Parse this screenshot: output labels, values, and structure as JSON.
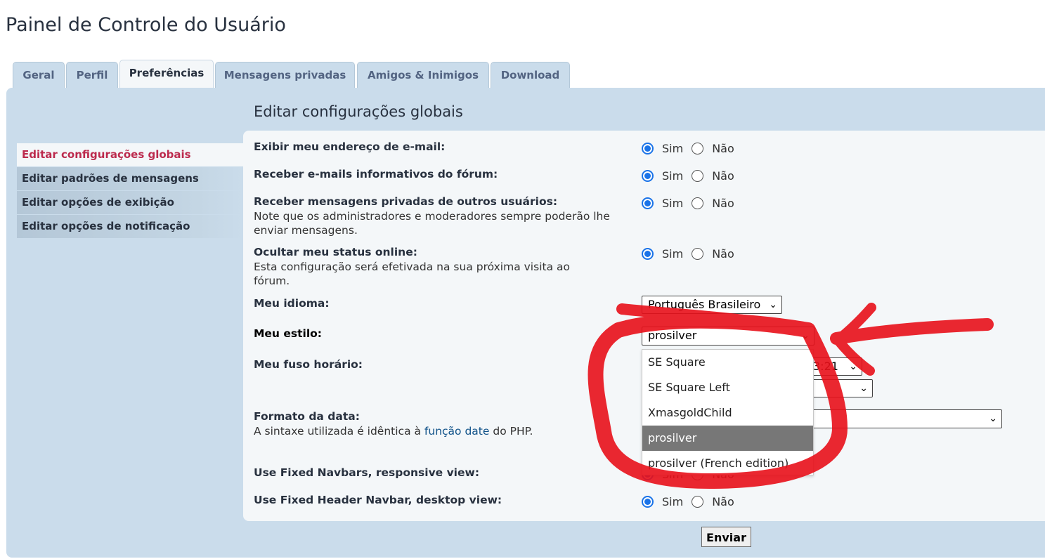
{
  "page_title": "Painel de Controle do Usuário",
  "tabs": [
    {
      "label": "Geral"
    },
    {
      "label": "Perfil"
    },
    {
      "label": "Preferências"
    },
    {
      "label": "Mensagens privadas"
    },
    {
      "label": "Amigos & Inimigos"
    },
    {
      "label": "Download"
    }
  ],
  "content_title": "Editar configurações globais",
  "sidebar": {
    "items": [
      {
        "label": "Editar configurações globais"
      },
      {
        "label": "Editar padrões de mensagens"
      },
      {
        "label": "Editar opções de exibição"
      },
      {
        "label": "Editar opções de notificação"
      }
    ]
  },
  "options": {
    "yes": "Sim",
    "no": "Não"
  },
  "fields": {
    "email": {
      "label": "Exibir meu endereço de e-mail:"
    },
    "massemail": {
      "label": "Receber e-mails informativos do fórum:"
    },
    "pm": {
      "label": "Receber mensagens privadas de outros usuários:",
      "explain": "Note que os administradores e moderadores sempre poderão lhe enviar mensagens."
    },
    "online": {
      "label": "Ocultar meu status online:",
      "explain": "Esta configuração será efetivada na sua próxima visita ao fórum."
    },
    "lang": {
      "label": "Meu idioma:",
      "value": "Português Brasileiro"
    },
    "style": {
      "label": "Meu estilo:",
      "value": "prosilver"
    },
    "timezone": {
      "label": "Meu fuso horário:",
      "value_partial": "3:21"
    },
    "dateformat": {
      "label": "Formato da data:",
      "explain_before": "A sintaxe utilizada é idêntica à ",
      "explain_link": "função date",
      "explain_after": " do PHP."
    },
    "fixed_navbars": {
      "label": "Use Fixed Navbars, responsive view:"
    },
    "fixed_header": {
      "label": "Use Fixed Header Navbar, desktop view:"
    }
  },
  "style_dropdown": {
    "options": [
      "SE Square",
      "SE Square Left",
      "XmasgoldChild",
      "prosilver",
      "prosilver (French edition)"
    ],
    "selected": "prosilver"
  },
  "submit_label": "Enviar",
  "colors": {
    "accent": "#1a73e8",
    "annotation": "#e8101a",
    "active_menu": "#bc2a4d"
  }
}
